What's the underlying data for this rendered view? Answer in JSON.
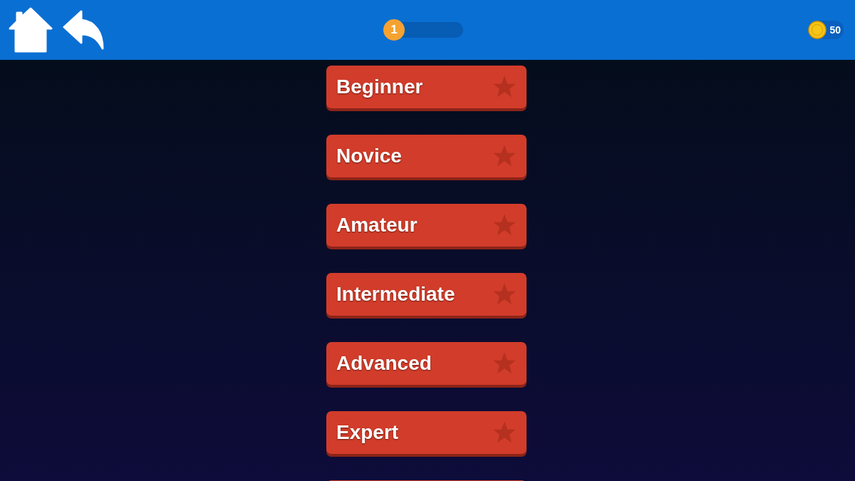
{
  "top_bar": {
    "player_level": "1",
    "xp_progress": {
      "level": 0
    },
    "coins": "50"
  },
  "levels": [
    {
      "label": "Beginner",
      "completed": false
    },
    {
      "label": "Novice",
      "completed": false
    },
    {
      "label": "Amateur",
      "completed": false
    },
    {
      "label": "Intermediate",
      "completed": false
    },
    {
      "label": "Advanced",
      "completed": false
    },
    {
      "label": "Expert",
      "completed": false
    }
  ]
}
